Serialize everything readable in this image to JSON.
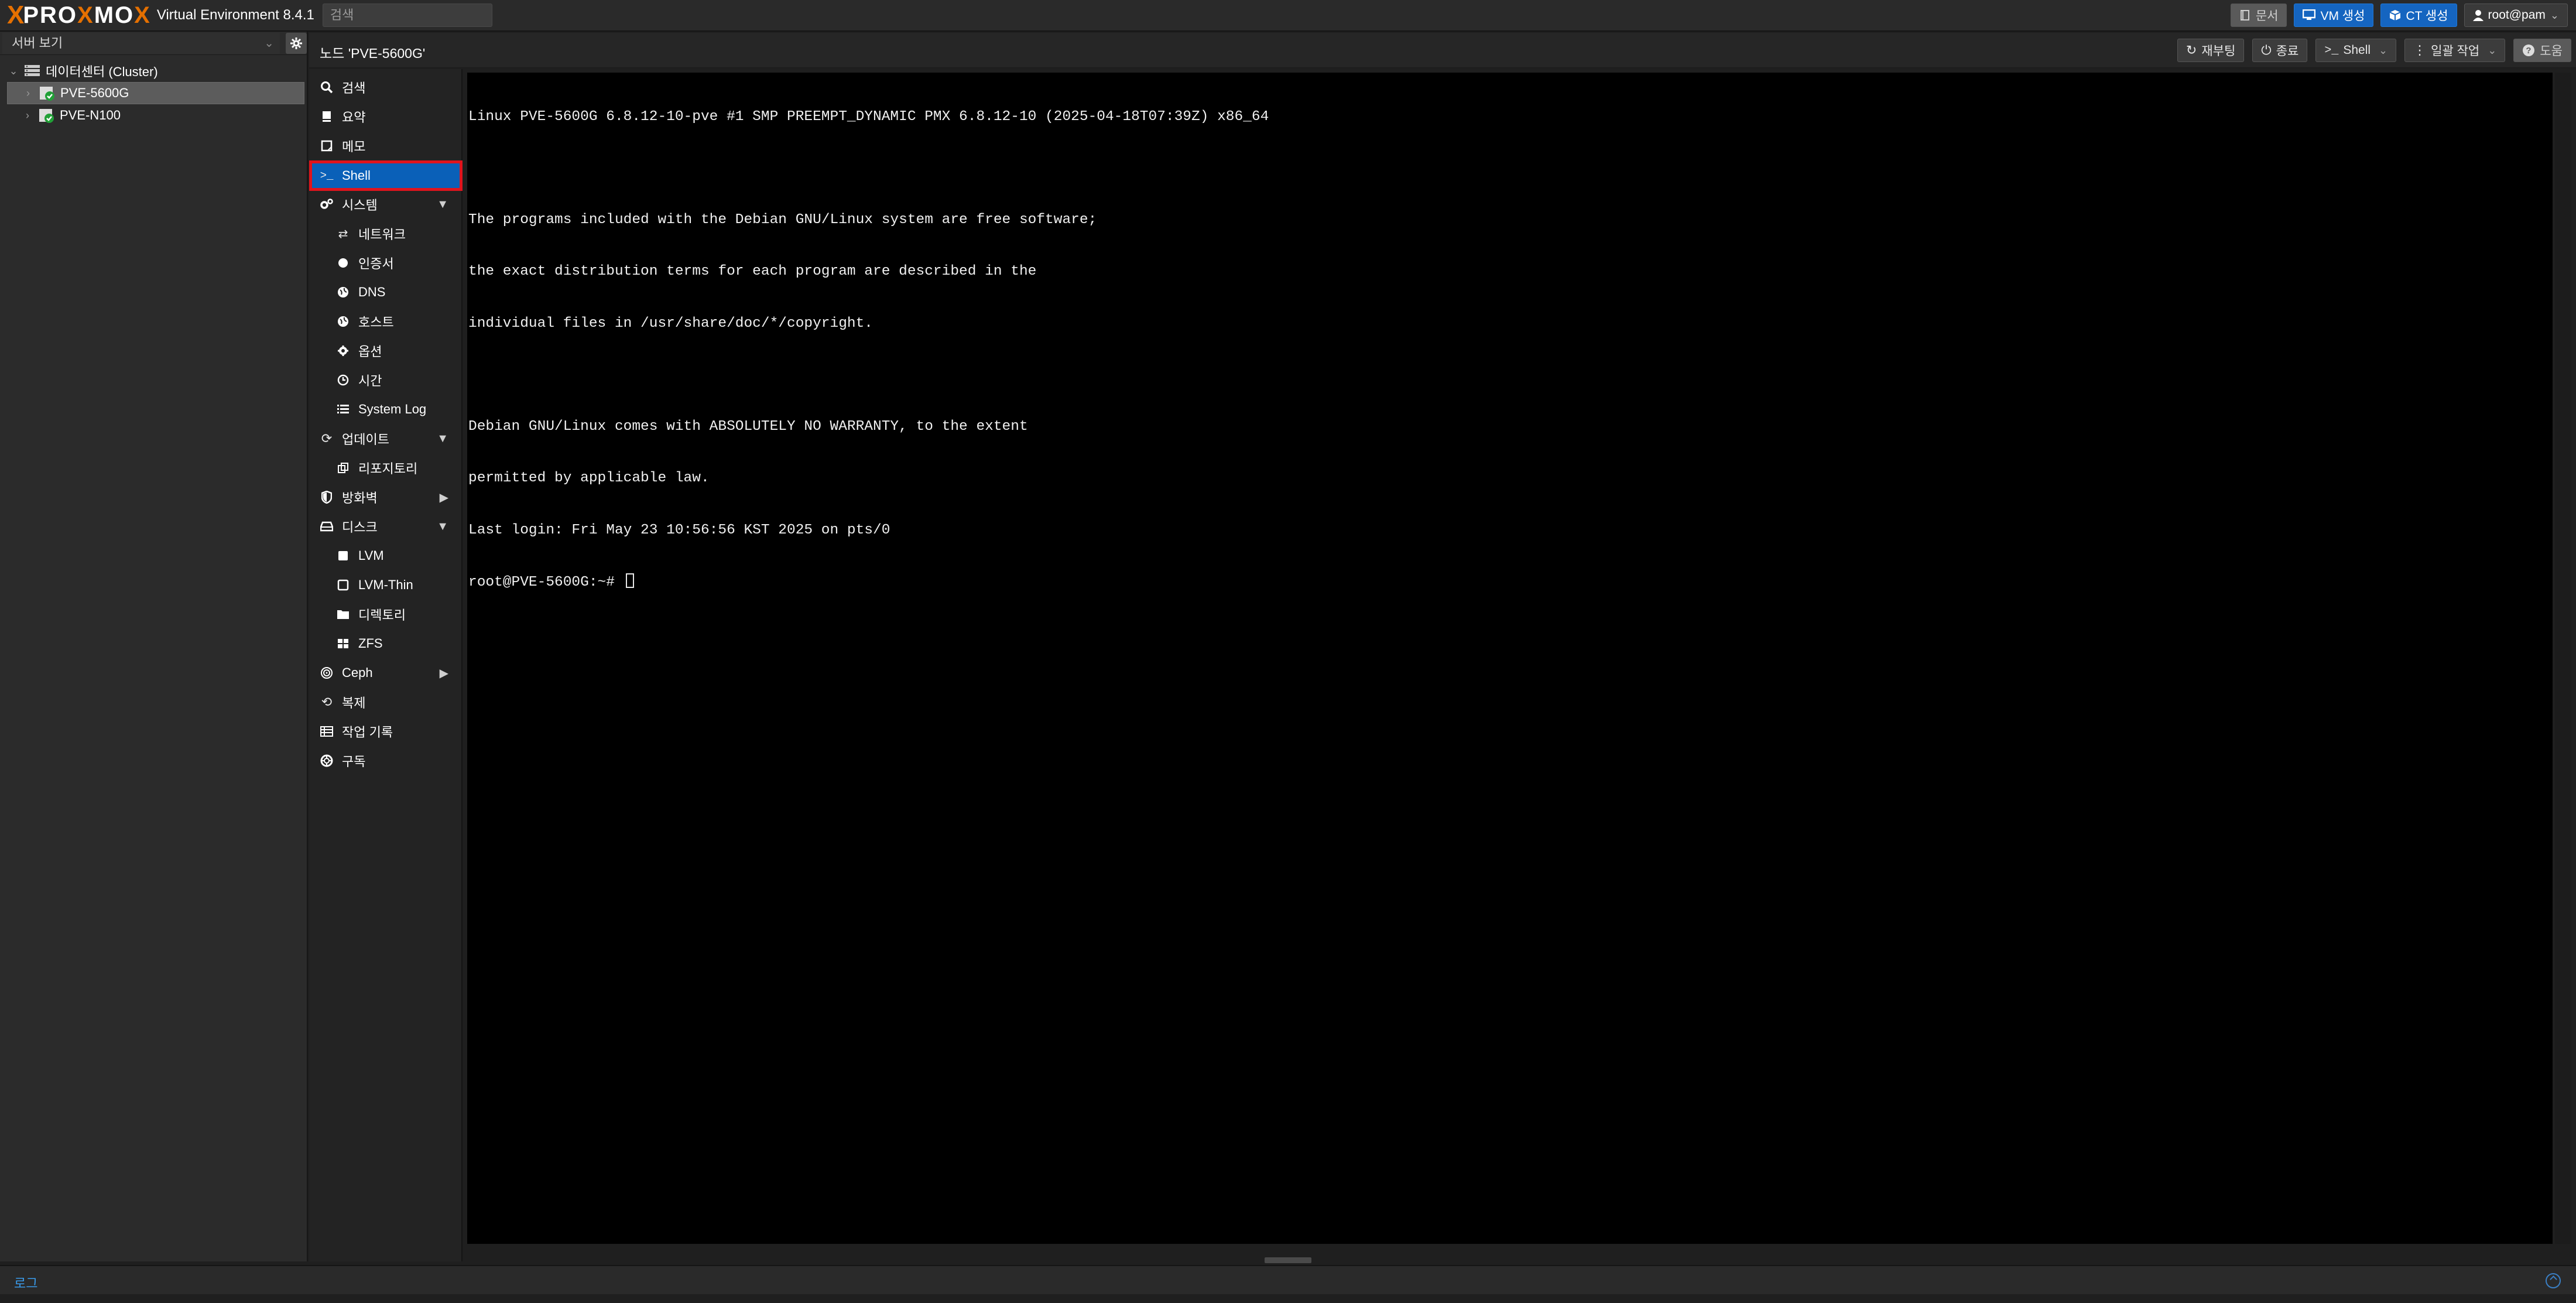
{
  "header": {
    "logo_x": "X",
    "logo_text_1": "PRO",
    "logo_text_2": "X",
    "logo_text_3": "MO",
    "logo_text_4": "X",
    "version": "Virtual Environment 8.4.1",
    "search_placeholder": "검색",
    "buttons": {
      "docs": "문서",
      "create_vm": "VM 생성",
      "create_ct": "CT 생성",
      "user": "root@pam"
    }
  },
  "left_panel": {
    "view_select": "서버 보기",
    "tree": {
      "datacenter": "데이터센터 (Cluster)",
      "nodes": [
        "PVE-5600G",
        "PVE-N100"
      ]
    }
  },
  "node_bar": {
    "title": "노드 'PVE-5600G'",
    "actions": {
      "reboot": "재부팅",
      "shutdown": "종료",
      "shell": "Shell",
      "bulk": "일괄 작업",
      "help": "도움"
    }
  },
  "menu": {
    "search": "검색",
    "summary": "요약",
    "notes": "메모",
    "shell": "Shell",
    "system": "시스템",
    "network": "네트워크",
    "certificates": "인증서",
    "dns": "DNS",
    "hosts": "호스트",
    "options": "옵션",
    "time": "시간",
    "syslog": "System Log",
    "updates": "업데이트",
    "repositories": "리포지토리",
    "firewall": "방화벽",
    "disks": "디스크",
    "lvm": "LVM",
    "lvm_thin": "LVM-Thin",
    "directory": "디렉토리",
    "zfs": "ZFS",
    "ceph": "Ceph",
    "replication": "복제",
    "task_history": "작업 기록",
    "subscription": "구독"
  },
  "terminal": {
    "lines": [
      "Linux PVE-5600G 6.8.12-10-pve #1 SMP PREEMPT_DYNAMIC PMX 6.8.12-10 (2025-04-18T07:39Z) x86_64",
      "",
      "The programs included with the Debian GNU/Linux system are free software;",
      "the exact distribution terms for each program are described in the",
      "individual files in /usr/share/doc/*/copyright.",
      "",
      "Debian GNU/Linux comes with ABSOLUTELY NO WARRANTY, to the extent",
      "permitted by applicable law.",
      "Last login: Fri May 23 10:56:56 KST 2025 on pts/0"
    ],
    "prompt": "root@PVE-5600G:~# "
  },
  "footer": {
    "log_label": "로그"
  },
  "colors": {
    "accent_orange": "#e57000",
    "selected_blue": "#0a60b8",
    "highlight_red": "#e0141d",
    "terminal_bg": "#000000"
  }
}
